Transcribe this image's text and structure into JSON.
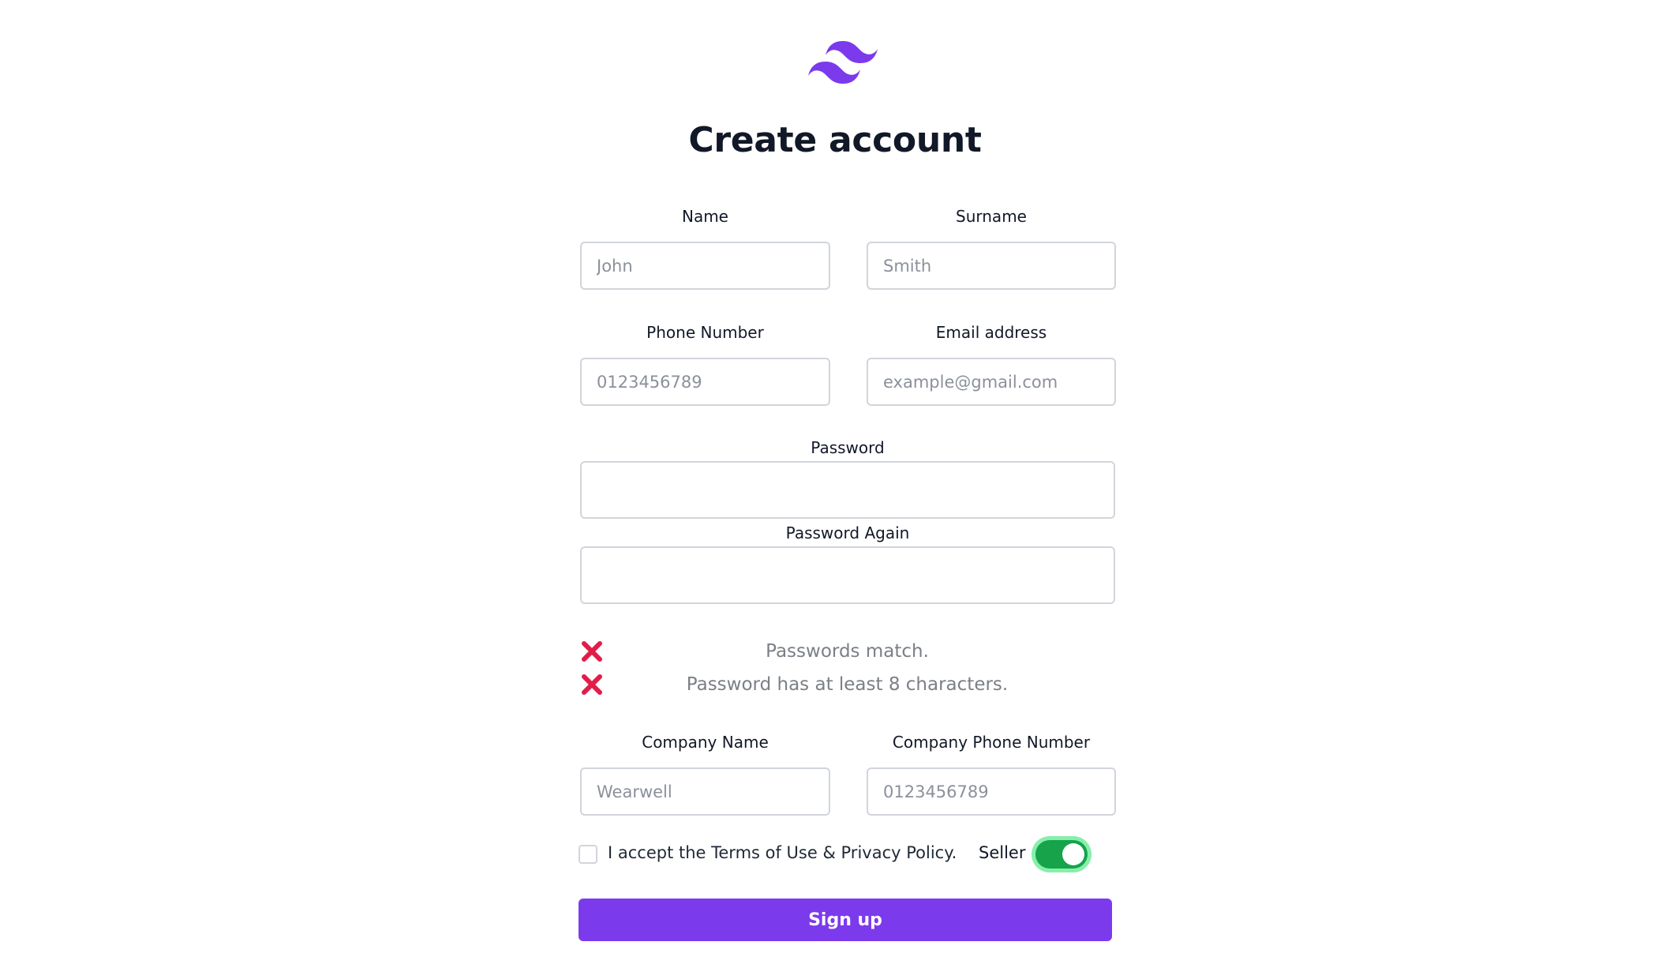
{
  "logo": {
    "icon": "tailwind-logo-icon",
    "color": "#7c3aed"
  },
  "page": {
    "title": "Create account"
  },
  "form": {
    "name": {
      "label": "Name",
      "placeholder": "John"
    },
    "surname": {
      "label": "Surname",
      "placeholder": "Smith"
    },
    "phone": {
      "label": "Phone Number",
      "placeholder": "0123456789"
    },
    "email": {
      "label": "Email address",
      "placeholder": "example@gmail.com"
    },
    "password": {
      "label": "Password",
      "value": ""
    },
    "password_again": {
      "label": "Password Again",
      "value": ""
    },
    "checks": [
      {
        "icon": "x-mark-icon",
        "text": "Passwords match.",
        "status_color": "#e11d48"
      },
      {
        "icon": "x-mark-icon",
        "text": "Password has at least 8 characters.",
        "status_color": "#e11d48"
      }
    ],
    "company_name": {
      "label": "Company Name",
      "placeholder": "Wearwell"
    },
    "company_phone": {
      "label": "Company Phone Number",
      "placeholder": "0123456789"
    },
    "terms": {
      "text": "I accept the Terms of Use & Privacy Policy.",
      "checked": false
    },
    "seller": {
      "label": "Seller",
      "on": true,
      "color": "#16a34a"
    },
    "submit_label": "Sign up",
    "accent": "#7c3aed"
  }
}
